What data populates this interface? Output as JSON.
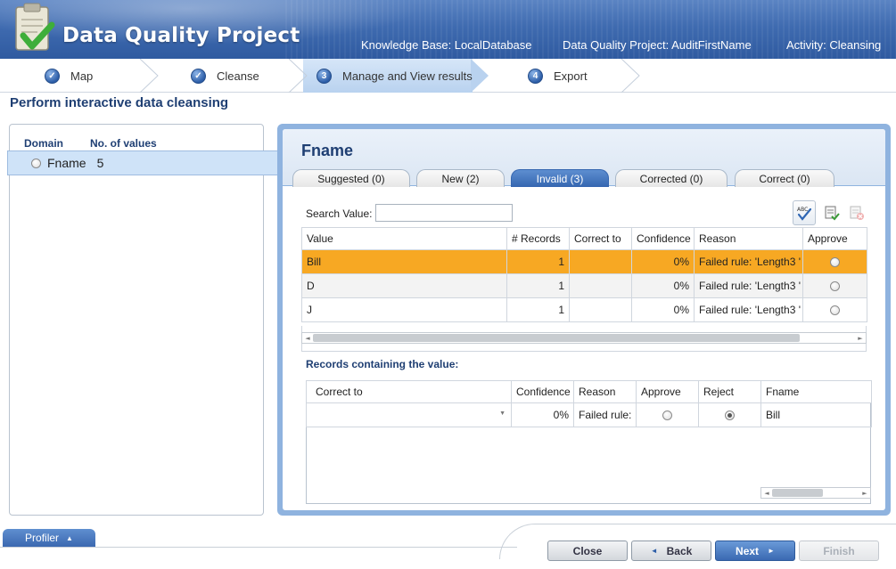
{
  "header": {
    "app_title": "Data Quality Project",
    "knowledge_base": "Knowledge Base: LocalDatabase",
    "project": "Data Quality Project: AuditFirstName",
    "activity": "Activity: Cleansing"
  },
  "steps": [
    {
      "num": "✓",
      "label": "Map",
      "state": "done"
    },
    {
      "num": "✓",
      "label": "Cleanse",
      "state": "done"
    },
    {
      "num": "3",
      "label": "Manage and View results",
      "state": "active"
    },
    {
      "num": "4",
      "label": "Export",
      "state": "pending"
    }
  ],
  "page_heading": "Perform interactive data cleansing",
  "domain_panel": {
    "col_domain": "Domain",
    "col_values": "No. of values",
    "row": {
      "name": "Fname",
      "count": "5"
    }
  },
  "detail": {
    "title": "Fname",
    "tabs": [
      {
        "label": "Suggested (0)",
        "active": false
      },
      {
        "label": "New (2)",
        "active": false
      },
      {
        "label": "Invalid (3)",
        "active": true
      },
      {
        "label": "Corrected (0)",
        "active": false
      },
      {
        "label": "Correct (0)",
        "active": false
      }
    ],
    "search_label": "Search Value:",
    "search_value": "",
    "values_table": {
      "headers": [
        "Value",
        "# Records",
        "Correct to",
        "Confidence",
        "Reason",
        "Approve"
      ],
      "rows": [
        {
          "value": "Bill",
          "records": "1",
          "correct_to": "",
          "confidence": "0%",
          "reason": "Failed rule: 'Length3 '",
          "selected": true
        },
        {
          "value": "D",
          "records": "1",
          "correct_to": "",
          "confidence": "0%",
          "reason": "Failed rule: 'Length3 '",
          "selected": false
        },
        {
          "value": "J",
          "records": "1",
          "correct_to": "",
          "confidence": "0%",
          "reason": "Failed rule: 'Length3 '",
          "selected": false
        }
      ]
    },
    "records_heading": "Records containing the value:",
    "records_table": {
      "headers": [
        "Correct to",
        "Confidence",
        "Reason",
        "Approve",
        "Reject",
        "Fname"
      ],
      "rows": [
        {
          "correct_to": "",
          "confidence": "0%",
          "reason": "Failed rule:",
          "fname": "Bill",
          "approve": false,
          "reject": true
        }
      ]
    }
  },
  "footer": {
    "profiler": "Profiler",
    "close": "Close",
    "back": "Back",
    "next": "Next",
    "finish": "Finish"
  }
}
